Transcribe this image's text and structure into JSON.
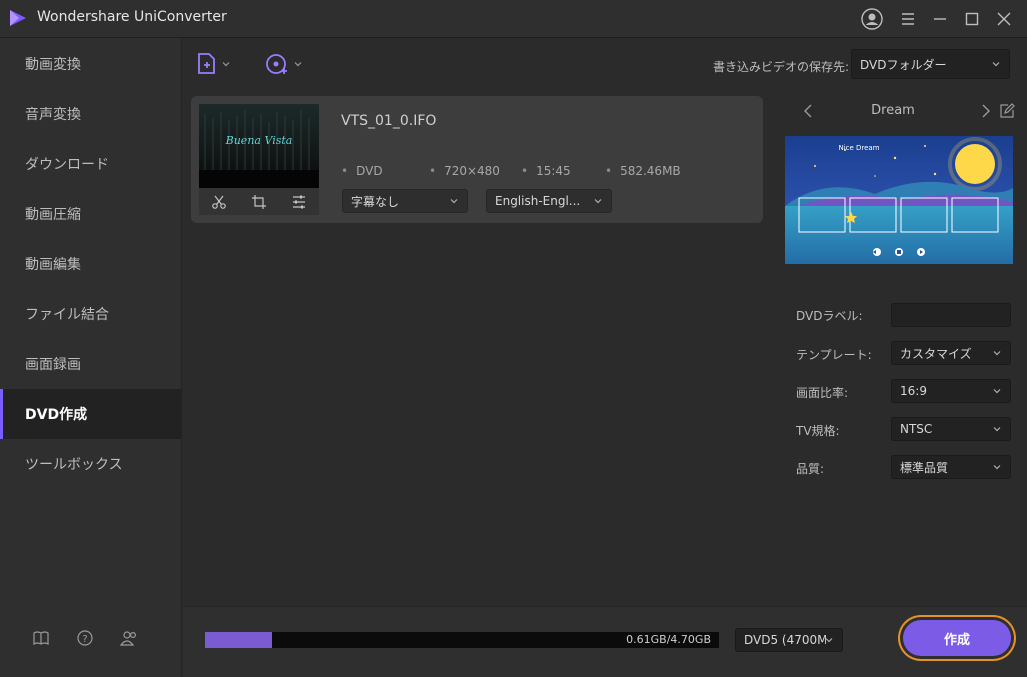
{
  "app": {
    "title": "Wondershare UniConverter",
    "accent": "#7b5cff"
  },
  "window_controls": [
    "account-icon",
    "menu-icon",
    "minimize-icon",
    "maximize-icon",
    "close-icon"
  ],
  "sidebar": {
    "items": [
      {
        "label": "動画変換",
        "active": false
      },
      {
        "label": "音声変換",
        "active": false
      },
      {
        "label": "ダウンロード",
        "active": false
      },
      {
        "label": "動画圧縮",
        "active": false
      },
      {
        "label": "動画編集",
        "active": false
      },
      {
        "label": "ファイル結合",
        "active": false
      },
      {
        "label": "画面録画",
        "active": false
      },
      {
        "label": "DVD作成",
        "active": true
      },
      {
        "label": "ツールボックス",
        "active": false
      }
    ],
    "footer_icons": [
      "book-icon",
      "help-icon",
      "account-icon"
    ]
  },
  "toolbar": {
    "save_to_label": "書き込みビデオの保存先:",
    "save_to_value": "DVDフォルダー"
  },
  "file": {
    "name": "VTS_01_0.IFO",
    "thumbnail_title": "Buena Vista",
    "format": "DVD",
    "resolution": "720×480",
    "duration": "15:45",
    "size": "582.46MB",
    "subtitle": "字幕なし",
    "audio": "English-Engl..."
  },
  "template": {
    "name": "Dream",
    "preview_title": "Nice Dream"
  },
  "settings": {
    "dvd_label": {
      "label": "DVDラベル:",
      "value": ""
    },
    "template": {
      "label": "テンプレート:",
      "value": "カスタマイズ"
    },
    "aspect": {
      "label": "画面比率:",
      "value": "16:9"
    },
    "tv_standard": {
      "label": "TV規格:",
      "value": "NTSC"
    },
    "quality": {
      "label": "品質:",
      "value": "標準品質"
    }
  },
  "bottom": {
    "progress_text": "0.61GB/4.70GB",
    "progress_fraction": 0.13,
    "disc_type": "DVD5 (4700M",
    "create_label": "作成"
  }
}
